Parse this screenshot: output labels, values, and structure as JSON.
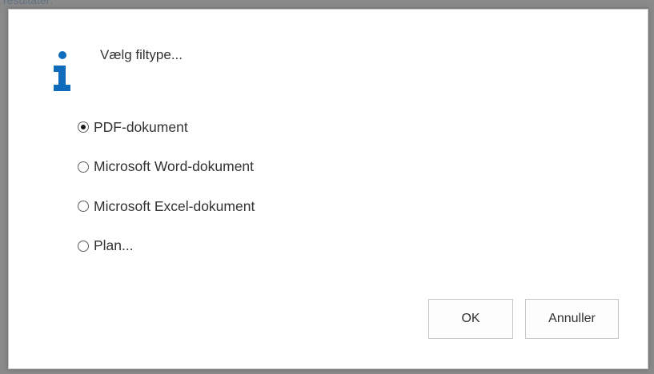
{
  "background": {
    "partial_text": "resultater:"
  },
  "dialog": {
    "icon": "info-icon",
    "accent_color": "#0f6cbd",
    "title": "Vælg filtype...",
    "options": [
      {
        "label": "PDF-dokument",
        "checked": true
      },
      {
        "label": "Microsoft Word-dokument",
        "checked": false
      },
      {
        "label": "Microsoft Excel-dokument",
        "checked": false
      },
      {
        "label": "Plan...",
        "checked": false
      }
    ],
    "buttons": {
      "ok_label": "OK",
      "cancel_label": "Annuller"
    }
  }
}
